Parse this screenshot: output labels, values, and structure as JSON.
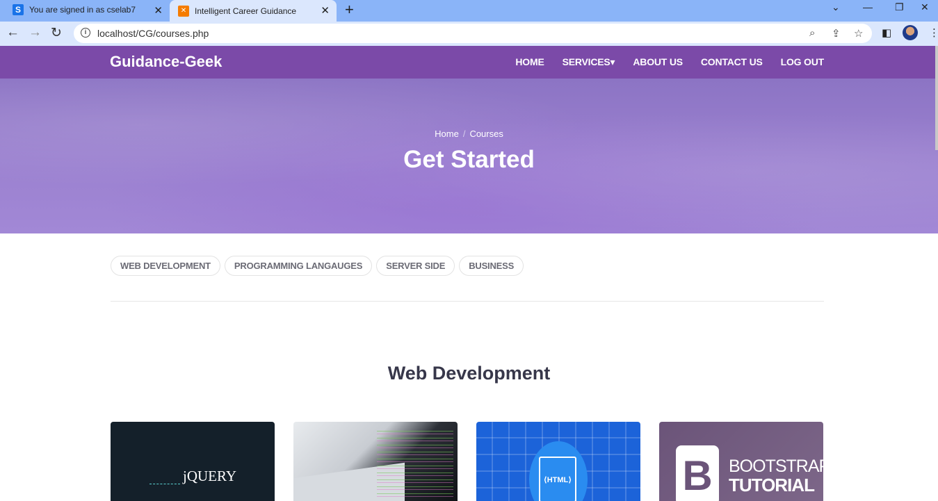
{
  "browser": {
    "tabs": [
      {
        "title": "You are signed in as cselab7",
        "favicon": "S",
        "favicon_color": "#1a73e8"
      },
      {
        "title": "Intelligent Career Guidance",
        "favicon": "✕",
        "favicon_color": "#f57c00"
      }
    ],
    "new_tab_label": "+",
    "url": "localhost/CG/courses.php"
  },
  "site": {
    "brand": "Guidance-Geek",
    "menu": [
      "HOME",
      "SERVICES▾",
      "ABOUT US",
      "CONTACT US",
      "LOG OUT"
    ],
    "breadcrumb": {
      "home": "Home",
      "separator": "/",
      "current": "Courses"
    },
    "hero_title": "Get Started",
    "filters": [
      "WEB DEVELOPMENT",
      "PROGRAMMING LANGAUGES",
      "SERVER SIDE",
      "BUSINESS"
    ],
    "section_title": "Web Development",
    "cards": [
      {
        "image_text": "jQUERY"
      },
      {
        "image_text": ""
      },
      {
        "image_text": "⟨HTML⟩"
      },
      {
        "image_text_1": "BOOTSTRAP",
        "image_text_2": "TUTORIAL",
        "logo_letter": "B"
      }
    ]
  },
  "colors": {
    "nav": "#7b4aa8",
    "hero": "#9a80cf",
    "tab_bar": "#8ab4f8"
  }
}
